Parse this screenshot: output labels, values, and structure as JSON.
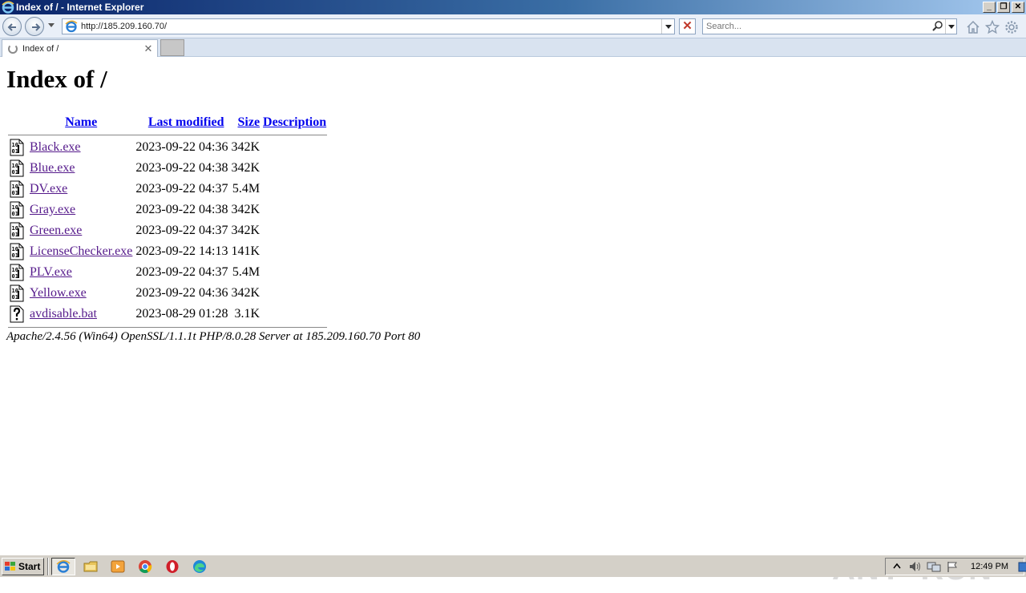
{
  "window": {
    "title": "Index of / - Internet Explorer"
  },
  "address_bar": {
    "url": "http://185.209.160.70/"
  },
  "search": {
    "placeholder": "Search..."
  },
  "tab": {
    "label": "Index of /"
  },
  "page": {
    "heading": "Index of /",
    "columns": {
      "name": "Name",
      "last_modified": "Last modified",
      "size": "Size",
      "description": "Description"
    },
    "files": [
      {
        "name": "Black.exe",
        "modified": "2023-09-22 04:36",
        "size": "342K",
        "icon": "binary-file-icon"
      },
      {
        "name": "Blue.exe",
        "modified": "2023-09-22 04:38",
        "size": "342K",
        "icon": "binary-file-icon"
      },
      {
        "name": "DV.exe",
        "modified": "2023-09-22 04:37",
        "size": "5.4M",
        "icon": "binary-file-icon"
      },
      {
        "name": "Gray.exe",
        "modified": "2023-09-22 04:38",
        "size": "342K",
        "icon": "binary-file-icon"
      },
      {
        "name": "Green.exe",
        "modified": "2023-09-22 04:37",
        "size": "342K",
        "icon": "binary-file-icon"
      },
      {
        "name": "LicenseChecker.exe",
        "modified": "2023-09-22 14:13",
        "size": "141K",
        "icon": "binary-file-icon"
      },
      {
        "name": "PLV.exe",
        "modified": "2023-09-22 04:37",
        "size": "5.4M",
        "icon": "binary-file-icon"
      },
      {
        "name": "Yellow.exe",
        "modified": "2023-09-22 04:36",
        "size": "342K",
        "icon": "binary-file-icon"
      },
      {
        "name": "avdisable.bat",
        "modified": "2023-08-29 01:28",
        "size": "3.1K",
        "icon": "unknown-file-icon"
      }
    ],
    "footer": "Apache/2.4.56 (Win64) OpenSSL/1.1.1t PHP/8.0.28 Server at 185.209.160.70 Port 80"
  },
  "watermark": {
    "left": "ANY",
    "right": "RUN"
  },
  "taskbar": {
    "start_label": "Start",
    "apps": [
      "internet-explorer-icon",
      "folder-icon",
      "media-player-icon",
      "chrome-icon",
      "opera-icon",
      "edge-icon"
    ],
    "clock": "12:49 PM"
  },
  "colors": {
    "link_visited": "#551a8b",
    "link": "#0000ee",
    "title_bar": "#0a246a",
    "taskbar": "#d4d0c8"
  }
}
